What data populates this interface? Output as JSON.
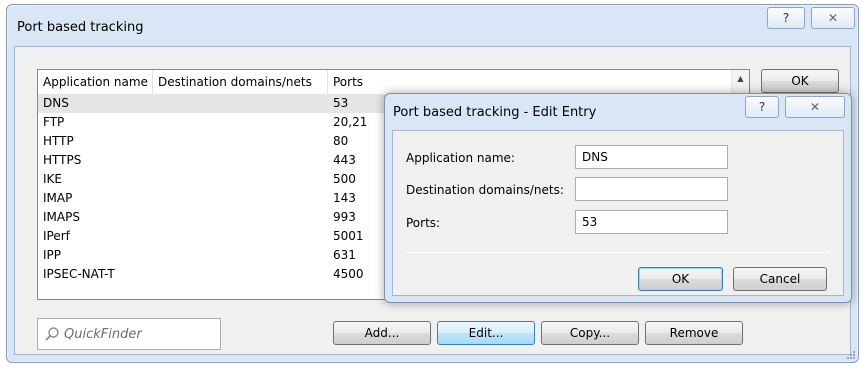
{
  "window": {
    "title": "Port based tracking",
    "help_glyph": "?",
    "close_glyph": "✕"
  },
  "table": {
    "columns": [
      "Application name",
      "Destination domains/nets",
      "Ports"
    ],
    "rows": [
      {
        "name": "DNS",
        "dest": "",
        "ports": "53"
      },
      {
        "name": "FTP",
        "dest": "",
        "ports": "20,21"
      },
      {
        "name": "HTTP",
        "dest": "",
        "ports": "80"
      },
      {
        "name": "HTTPS",
        "dest": "",
        "ports": "443"
      },
      {
        "name": "IKE",
        "dest": "",
        "ports": "500"
      },
      {
        "name": "IMAP",
        "dest": "",
        "ports": "143"
      },
      {
        "name": "IMAPS",
        "dest": "",
        "ports": "993"
      },
      {
        "name": "IPerf",
        "dest": "",
        "ports": "5001"
      },
      {
        "name": "IPP",
        "dest": "",
        "ports": "631"
      },
      {
        "name": "IPSEC-NAT-T",
        "dest": "",
        "ports": "4500"
      }
    ],
    "selected_row": 0
  },
  "buttons": {
    "ok": "OK",
    "add": "Add...",
    "edit": "Edit...",
    "copy": "Copy...",
    "remove": "Remove"
  },
  "quickfinder": {
    "placeholder": "QuickFinder"
  },
  "dialog": {
    "title": "Port based tracking - Edit Entry",
    "help_glyph": "?",
    "close_glyph": "✕",
    "fields": {
      "app_label": "Application name:",
      "app_value": "DNS",
      "dest_label": "Destination domains/nets:",
      "dest_value": "",
      "ports_label": "Ports:",
      "ports_value": "53"
    },
    "ok": "OK",
    "cancel": "Cancel"
  }
}
